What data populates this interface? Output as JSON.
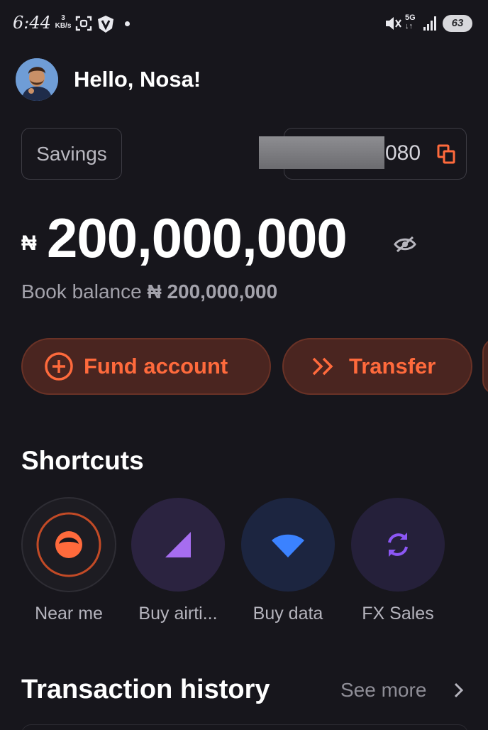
{
  "status_bar": {
    "time": "6:44",
    "net_speed_value": "3",
    "net_speed_unit": "KB/s",
    "network_type": "5G",
    "battery": "63"
  },
  "header": {
    "greeting": "Hello, Nosa!",
    "avatar_icon": "avatar"
  },
  "account": {
    "type": "Savings",
    "number_suffix": "080",
    "copy_icon": "copy-icon"
  },
  "balance": {
    "currency": "₦",
    "amount": "200,000,000",
    "book_balance_label": "Book balance",
    "book_balance_value": "₦ 200,000,000"
  },
  "actions": {
    "fund": "Fund account",
    "transfer": "Transfer"
  },
  "shortcuts": {
    "title": "Shortcuts",
    "items": [
      {
        "label": "Near me",
        "icon": "near-me-icon"
      },
      {
        "label": "Buy airti...",
        "icon": "airtime-icon"
      },
      {
        "label": "Buy data",
        "icon": "wifi-icon"
      },
      {
        "label": "FX Sales",
        "icon": "exchange-icon"
      }
    ]
  },
  "transactions": {
    "title": "Transaction history",
    "see_more": "See more"
  },
  "colors": {
    "background": "#17161c",
    "accent": "#ff6a3c",
    "button_bg": "#4a2520"
  }
}
